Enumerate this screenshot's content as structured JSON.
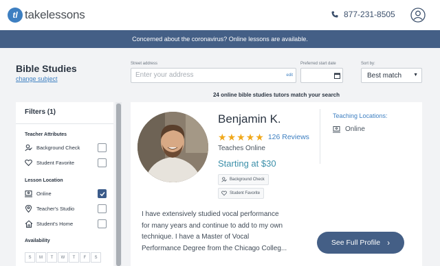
{
  "header": {
    "logo_text": "takelessons",
    "logo_mark": "tl",
    "phone": "877-231-8505",
    "phone_icon": "phone-icon",
    "user_icon": "user-icon"
  },
  "banner": {
    "text": "Concerned about the coronavirus? Online lessons are available."
  },
  "search": {
    "title": "Bible Studies",
    "change_subject": "change subject",
    "street_label": "Street address",
    "street_placeholder": "Enter your address",
    "edit": "edit",
    "date_label": "Preferred start date",
    "sort_label": "Sort by:",
    "sort_value": "Best match",
    "match_text": "24 online bible studies tutors match your search"
  },
  "filters": {
    "title": "Filters (1)",
    "teacher_attributes_label": "Teacher Attributes",
    "attributes": [
      {
        "label": "Background Check",
        "checked": false,
        "icon": "person-check-icon"
      },
      {
        "label": "Student Favorite",
        "checked": false,
        "icon": "heart-icon"
      }
    ],
    "lesson_location_label": "Lesson Location",
    "locations": [
      {
        "label": "Online",
        "checked": true,
        "icon": "laptop-icon"
      },
      {
        "label": "Teacher's Studio",
        "checked": false,
        "icon": "pin-icon"
      },
      {
        "label": "Student's Home",
        "checked": false,
        "icon": "home-icon"
      }
    ],
    "availability_label": "Availability",
    "days": [
      "S",
      "M",
      "T",
      "W",
      "T",
      "F",
      "S"
    ]
  },
  "card": {
    "name": "Benjamin K.",
    "rating": 5,
    "reviews": "126 Reviews",
    "teaches": "Teaches Online",
    "price": "Starting at $30",
    "badges": [
      "Background Check",
      "Student Favorite"
    ],
    "teaching_locations_label": "Teaching Locations:",
    "location": "Online",
    "bio_lines": [
      "I have extensively studied vocal performance",
      "for many years and continue to add to my own",
      "technique. I have a Master of Vocal",
      "Performance Degree from the Chicago Colleg..."
    ],
    "button": "See Full Profile"
  },
  "colors": {
    "brand": "#445f86",
    "link": "#3d7fc1",
    "star": "#f0a81b",
    "price": "#3b8fa9"
  }
}
